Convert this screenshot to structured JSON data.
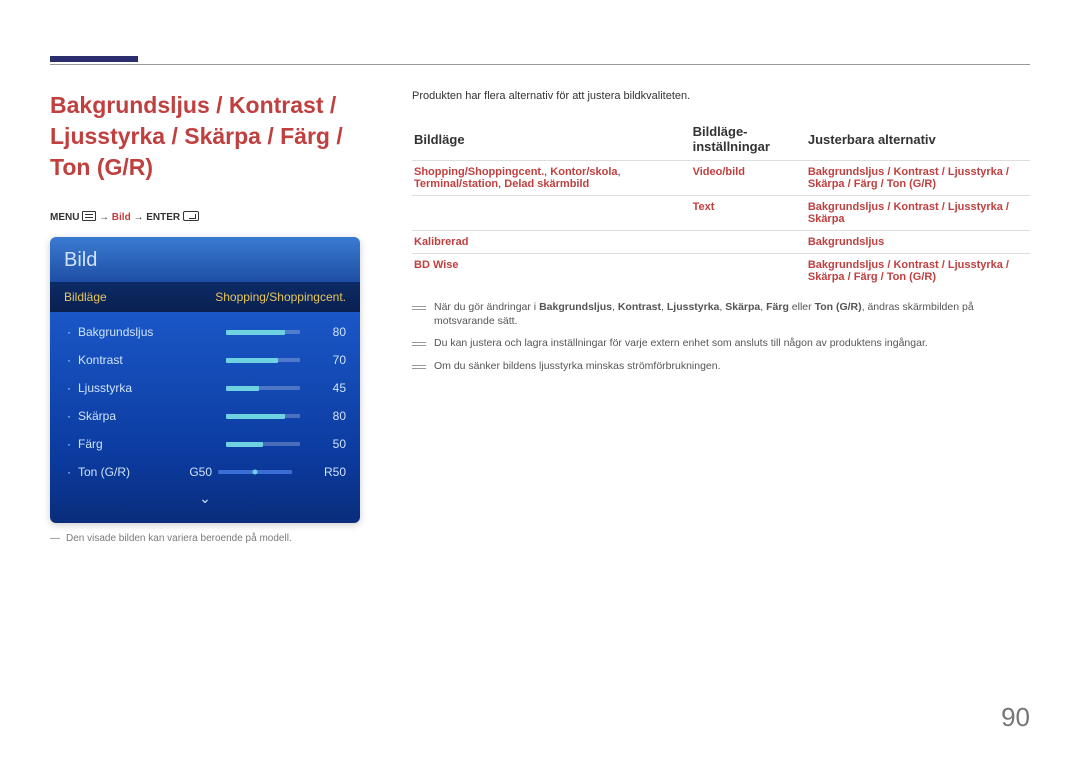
{
  "page_number": "90",
  "section_title": "Bakgrundsljus / Kontrast / Ljusstyrka / Skärpa / Färg / Ton (G/R)",
  "menu_path": {
    "prefix": "MENU",
    "arrow1": "→",
    "bild": "Bild",
    "arrow2": "→",
    "enter": "ENTER"
  },
  "tv_menu": {
    "title": "Bild",
    "selected_label": "Bildläge",
    "selected_value": "Shopping/Shoppingcent.",
    "rows": [
      {
        "label": "Bakgrundsljus",
        "value": "80",
        "fill": 80
      },
      {
        "label": "Kontrast",
        "value": "70",
        "fill": 70
      },
      {
        "label": "Ljusstyrka",
        "value": "45",
        "fill": 45
      },
      {
        "label": "Skärpa",
        "value": "80",
        "fill": 80
      },
      {
        "label": "Färg",
        "value": "50",
        "fill": 50
      }
    ],
    "tint": {
      "label": "Ton (G/R)",
      "g": "G50",
      "r": "R50"
    }
  },
  "left_footnote": "Den visade bilden kan variera beroende på modell.",
  "intro_text": "Produkten har flera alternativ för att justera bildkvaliteten.",
  "table": {
    "headers": [
      "Bildläge",
      "Bildläge-inställningar",
      "Justerbara alternativ"
    ],
    "rows": [
      {
        "c0a": "Shopping/Shoppingcent.",
        "c0_sep1": ", ",
        "c0b": "Kontor/skola",
        "c0_sep2": ", ",
        "c0c": "Terminal/station",
        "c0_sep3": ", ",
        "c0d": "Delad skärmbild",
        "c1": "Video/bild",
        "c2a": "Bakgrundsljus",
        "sep_a": " / ",
        "c2b": "Kontrast",
        "sep_b": " / ",
        "c2c": "Ljusstyrka",
        "sep_c": " / ",
        "c2d": "Skärpa",
        "sep_d": " / ",
        "c2e": "Färg",
        "sep_e": " / ",
        "c2f": "Ton (G/R)"
      },
      {
        "c1": "Text",
        "c2a": "Bakgrundsljus",
        "sep_a": " / ",
        "c2b": "Kontrast",
        "sep_b": " / ",
        "c2c": "Ljusstyrka",
        "sep_c": " / ",
        "c2d": "Skärpa"
      },
      {
        "c0a": "Kalibrerad",
        "c2a": "Bakgrundsljus"
      },
      {
        "c0a": "BD Wise",
        "c2a": "Bakgrundsljus",
        "sep_a": " / ",
        "c2b": "Kontrast",
        "sep_b": " / ",
        "c2c": "Ljusstyrka",
        "sep_c": " / ",
        "c2d": "Skärpa",
        "sep_d": " / ",
        "c2e": "Färg",
        "sep_e": " / ",
        "c2f": "Ton (G/R)"
      }
    ]
  },
  "notes": [
    {
      "pre": "När du gör ändringar i ",
      "b1": "Bakgrundsljus",
      "s1": ", ",
      "b2": "Kontrast",
      "s2": ", ",
      "b3": "Ljusstyrka",
      "s3": ", ",
      "b4": "Skärpa",
      "s4": ", ",
      "b5": "Färg",
      "s5": " eller ",
      "b6": "Ton (G/R)",
      "post": ", ändras skärmbilden på motsvarande sätt."
    },
    {
      "text": "Du kan justera och lagra inställningar för varje extern enhet som ansluts till någon av produktens ingångar."
    },
    {
      "text": "Om du sänker bildens ljusstyrka minskas strömförbrukningen."
    }
  ]
}
